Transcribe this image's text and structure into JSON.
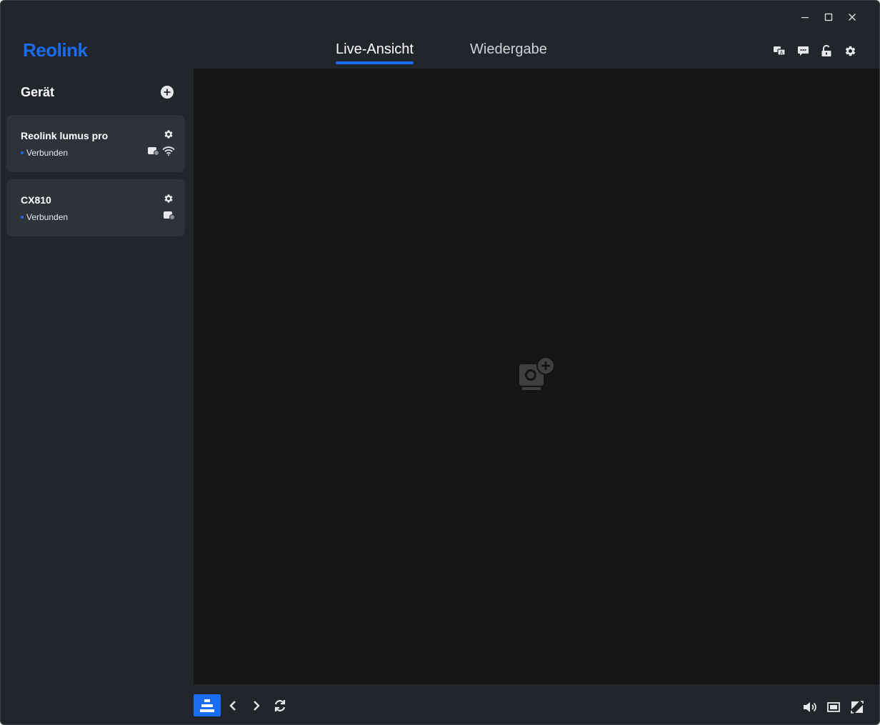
{
  "window": {
    "controls": [
      "minimize",
      "maximize",
      "close"
    ]
  },
  "header": {
    "logo": "Reolink",
    "tabs": [
      {
        "label": "Live-Ansicht",
        "active": true
      },
      {
        "label": "Wiedergabe",
        "active": false
      }
    ],
    "icons": [
      "language-icon",
      "message-icon",
      "lock-icon",
      "settings-gear-icon"
    ]
  },
  "sidebar": {
    "title": "Gerät",
    "devices": [
      {
        "name": "Reolink lumus pro",
        "status": "Verbunden",
        "icons": [
          "device-icon",
          "wifi-icon"
        ]
      },
      {
        "name": "CX810",
        "status": "Verbunden",
        "icons": [
          "device-icon"
        ]
      }
    ]
  },
  "colors": {
    "accent": "#1a6cf0",
    "background": "#22252c",
    "card": "#2e323b",
    "video": "#151515"
  },
  "toolbar": {
    "left_icons": [
      "layout-icon",
      "chevron-left-icon",
      "chevron-right-icon",
      "refresh-icon"
    ],
    "right_icons": [
      "volume-icon",
      "screen-icon",
      "fullscreen-icon"
    ]
  }
}
